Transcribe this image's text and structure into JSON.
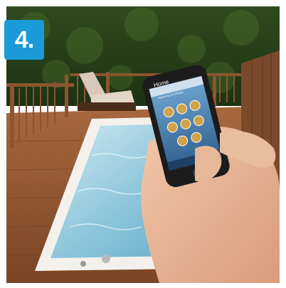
{
  "step_badge": {
    "label": "4.",
    "color": "#1a9ad6"
  },
  "phone_screen": {
    "title": "Home",
    "subtitle": "Welcome to InTouch",
    "icons": [
      "jets-icon",
      "light-icon",
      "heat-icon",
      "pump-icon",
      "music-icon",
      "settings-icon",
      "timer-icon",
      "info-icon"
    ]
  }
}
